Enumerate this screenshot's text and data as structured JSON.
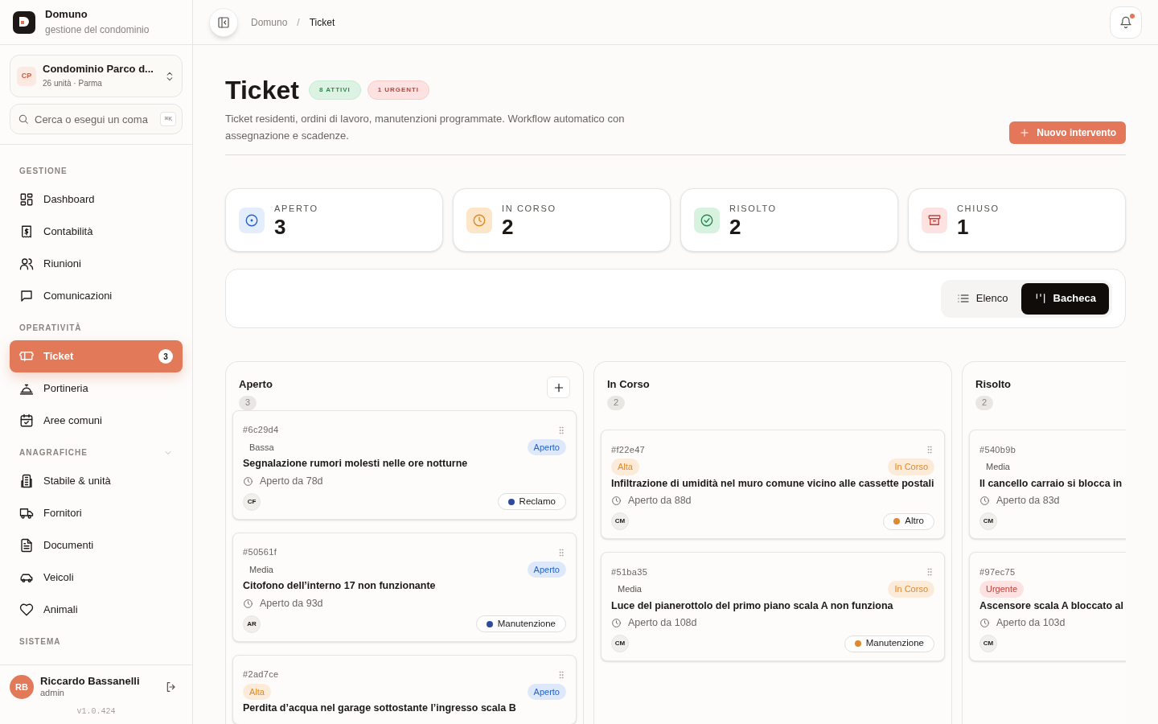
{
  "app": {
    "name": "Domuno",
    "tagline": "gestione del condominio"
  },
  "condo": {
    "initials": "CP",
    "name": "Condominio Parco d...",
    "meta": "26 unità · Parma"
  },
  "search": {
    "placeholder": "Cerca o esegui un coma",
    "shortcut": "⌘K"
  },
  "nav": [
    {
      "title": "GESTIONE",
      "kind": "plain",
      "items": [
        {
          "label": "Dashboard",
          "selected": false
        },
        {
          "label": "Contabilità",
          "selected": false
        },
        {
          "label": "Riunioni",
          "selected": false
        },
        {
          "label": "Comunicazioni",
          "selected": false
        }
      ]
    },
    {
      "title": "OPERATIVITÀ",
      "kind": "plain",
      "items": [
        {
          "label": "Ticket",
          "selected": true,
          "badge": "3"
        },
        {
          "label": "Portineria",
          "selected": false
        },
        {
          "label": "Aree comuni",
          "selected": false
        }
      ]
    },
    {
      "title": "ANAGRAFICHE",
      "kind": "collapsible",
      "items": [
        {
          "label": "Stabile & unità",
          "selected": false
        },
        {
          "label": "Fornitori",
          "selected": false
        },
        {
          "label": "Documenti",
          "selected": false
        },
        {
          "label": "Veicoli",
          "selected": false
        },
        {
          "label": "Animali",
          "selected": false
        }
      ]
    },
    {
      "title": "SISTEMA",
      "kind": "plain"
    }
  ],
  "user": {
    "initials": "RB",
    "name": "Riccardo Bassanelli",
    "role": "admin"
  },
  "version": "v1.0.424",
  "breadcrumb": {
    "separator": "/",
    "items": [
      "Domuno",
      "Ticket"
    ]
  },
  "page": {
    "title": "Ticket",
    "badges": [
      {
        "label": "8 ATTIVI",
        "kind": "success"
      },
      {
        "label": "1 URGENTI",
        "kind": "danger"
      }
    ],
    "description": "Ticket residenti, ordini di lavoro, manutenzioni programmate. Workflow automatico con assegnazione e scadenze.",
    "primary_button": "Nuovo intervento"
  },
  "stats": [
    {
      "label": "APERTO",
      "value": "3",
      "kind": "open"
    },
    {
      "label": "IN CORSO",
      "value": "2",
      "kind": "progress"
    },
    {
      "label": "RISOLTO",
      "value": "2",
      "kind": "resolved"
    },
    {
      "label": "CHIUSO",
      "value": "1",
      "kind": "closed"
    }
  ],
  "view_toggle": [
    {
      "label": "Elenco",
      "selected": false
    },
    {
      "label": "Bacheca",
      "selected": true
    }
  ],
  "columns": [
    {
      "name": "Aperto",
      "count": "3",
      "add_button": true,
      "cards": [
        {
          "id": "#6c29d4",
          "priority": {
            "label": "Bassa",
            "kind": "low"
          },
          "status": {
            "label": "Aperto",
            "kind": "open"
          },
          "title": "Segnalazione rumori molesti nelle ore notturne",
          "age": "Aperto da 78d",
          "assignee": "CF",
          "category": {
            "label": "Reclamo",
            "color": "#2f4a9c"
          }
        },
        {
          "id": "#50561f",
          "priority": {
            "label": "Media",
            "kind": "medium"
          },
          "status": {
            "label": "Aperto",
            "kind": "open"
          },
          "title": "Citofono dell’interno 17 non funzionante",
          "age": "Aperto da 93d",
          "assignee": "AR",
          "category": {
            "label": "Manutenzione",
            "color": "#2f4a9c"
          }
        },
        {
          "id": "#2ad7ce",
          "priority": {
            "label": "Alta",
            "kind": "high"
          },
          "status": {
            "label": "Aperto",
            "kind": "open"
          },
          "title": "Perdita d’acqua nel garage sottostante l’ingresso scala B"
        }
      ]
    },
    {
      "name": "In Corso",
      "count": "2",
      "add_button": false,
      "cards": [
        {
          "id": "#f22e47",
          "priority": {
            "label": "Alta",
            "kind": "high"
          },
          "status": {
            "label": "In Corso",
            "kind": "progress"
          },
          "title": "Infiltrazione di umidità nel muro comune vicino alle cassette postali",
          "age": "Aperto da 88d",
          "assignee": "CM",
          "category": {
            "label": "Altro",
            "color": "#e0892f"
          }
        },
        {
          "id": "#51ba35",
          "priority": {
            "label": "Media",
            "kind": "medium"
          },
          "status": {
            "label": "In Corso",
            "kind": "progress"
          },
          "title": "Luce del pianerottolo del primo piano scala A non funziona",
          "age": "Aperto da 108d",
          "assignee": "CM",
          "category": {
            "label": "Manutenzione",
            "color": "#e0892f"
          }
        }
      ]
    },
    {
      "name": "Risolto",
      "count": "2",
      "cards": [
        {
          "id": "#540b9b",
          "priority": {
            "label": "Media",
            "kind": "medium"
          },
          "title": "Il cancello carraio si blocca in",
          "age": "Aperto da 83d",
          "assignee": "CM"
        },
        {
          "id": "#97ec75",
          "priority": {
            "label": "Urgente",
            "kind": "urgent"
          },
          "title": "Ascensore scala A bloccato al",
          "age": "Aperto da 103d",
          "assignee": "CM"
        }
      ]
    }
  ]
}
